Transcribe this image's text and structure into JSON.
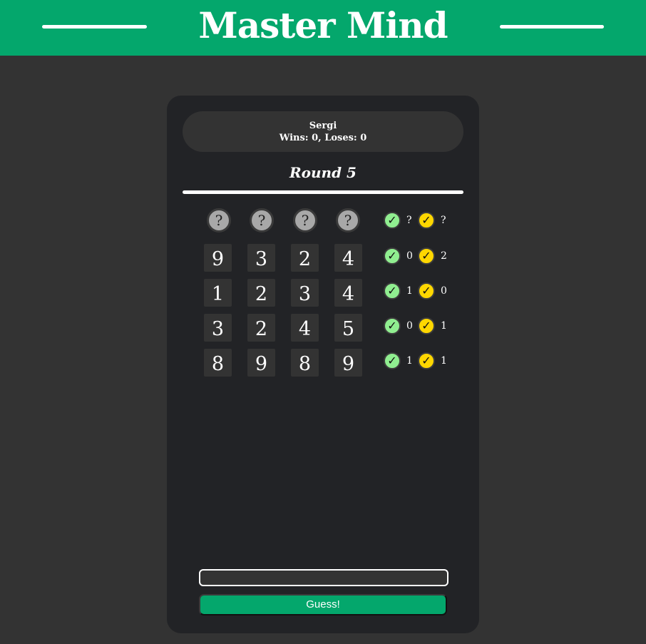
{
  "header": {
    "title": "Master Mind"
  },
  "player": {
    "name": "Sergi",
    "stats": "Wins: 0, Loses: 0"
  },
  "round": {
    "label": "Round 5"
  },
  "secret": {
    "pegs": [
      "?",
      "?",
      "?",
      "?"
    ],
    "correct_count": "?",
    "misplaced_count": "?"
  },
  "guesses": [
    {
      "digits": [
        "9",
        "3",
        "2",
        "4"
      ],
      "correct": "0",
      "misplaced": "2"
    },
    {
      "digits": [
        "1",
        "2",
        "3",
        "4"
      ],
      "correct": "1",
      "misplaced": "0"
    },
    {
      "digits": [
        "3",
        "2",
        "4",
        "5"
      ],
      "correct": "0",
      "misplaced": "1"
    },
    {
      "digits": [
        "8",
        "9",
        "8",
        "9"
      ],
      "correct": "1",
      "misplaced": "1"
    }
  ],
  "feedback_icons": {
    "correct": "check-green-icon",
    "misplaced": "check-yellow-icon",
    "glyph": "✓"
  },
  "colors": {
    "brand_green": "#04a76c",
    "page_background": "#333333",
    "panel_background": "#222326",
    "correct_green": "#90ee90",
    "misplaced_yellow": "#ffd700"
  },
  "form": {
    "input_value": "",
    "input_placeholder": "",
    "button_label": "Guess!"
  }
}
